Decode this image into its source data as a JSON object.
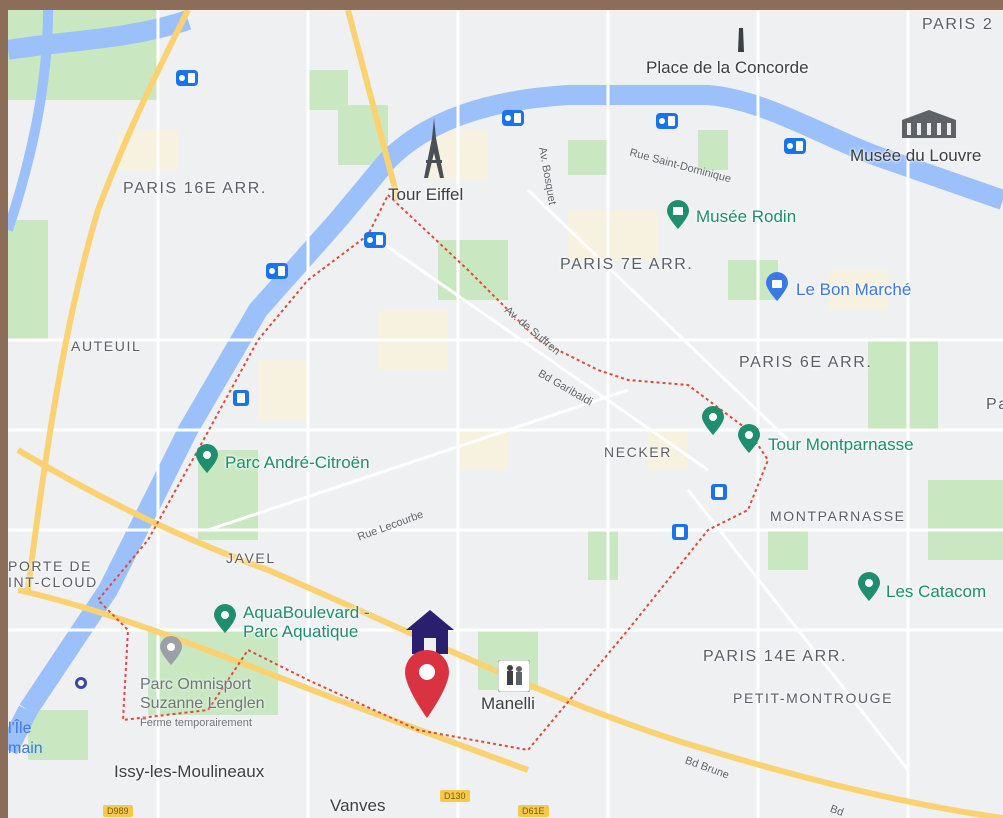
{
  "map": {
    "districts": {
      "paris2": "PARIS 2",
      "paris16": "PARIS 16E ARR.",
      "paris7": "PARIS 7E ARR.",
      "paris6": "PARIS 6E ARR.",
      "paris14": "PARIS 14E ARR.",
      "auteuil": "AUTEUIL",
      "necker": "NECKER",
      "javel": "JAVEL",
      "montparnasse": "MONTPARNASSE",
      "petit_montrouge": "PETIT-MONTROUGE",
      "porte_de": "PORTE DE",
      "int_cloud": "INT-CLOUD",
      "right_edge_p": "Pa"
    },
    "places": {
      "concorde": "Place de la Concorde",
      "louvre": "Musée du Louvre",
      "eiffel": "Tour Eiffel",
      "rodin": "Musée Rodin",
      "bon_marche": "Le Bon Marché",
      "montparnasse_tower": "Tour Montparnasse",
      "catacombs": "Les Catacom",
      "citroen": "Parc André-Citroën",
      "aquaboulevard_1": "AquaBoulevard -",
      "aquaboulevard_2": "Parc Aquatique",
      "omnisport_1": "Parc Omnisport",
      "omnisport_2": "Suzanne Lenglen",
      "omnisport_3": "Ferme temporairement",
      "manelli": "Manelli",
      "issy": "Issy-les-Moulineaux",
      "vanves": "Vanves",
      "ile_1": "l'Île",
      "ile_2": "main"
    },
    "streets": {
      "bosquet": "Av. Bosquet",
      "saint_dominique": "Rue Saint-Dominique",
      "suffren": "Av. de Suffren",
      "garibaldi": "Bd Garibaldi",
      "lecourbe": "Rue Lecourbe",
      "brune": "Bd Brune",
      "bd": "Bd"
    },
    "road_shields": {
      "d989": "D989",
      "d130": "D130",
      "d61e": "D61E"
    },
    "icons": {
      "home": "home-marker-icon",
      "pin": "location-pin-icon",
      "metro": "metro-station-icon",
      "museum": "museum-icon",
      "shopping": "shopping-icon",
      "park": "park-icon",
      "attraction": "camera-icon",
      "person": "figure-icon"
    },
    "colors": {
      "water": "#9cc0f9",
      "park": "#c9e8c2",
      "major_road": "#fbd272",
      "boundary": "#e04a3a",
      "pin": "#d93342",
      "home": "#2a1e6e"
    }
  }
}
